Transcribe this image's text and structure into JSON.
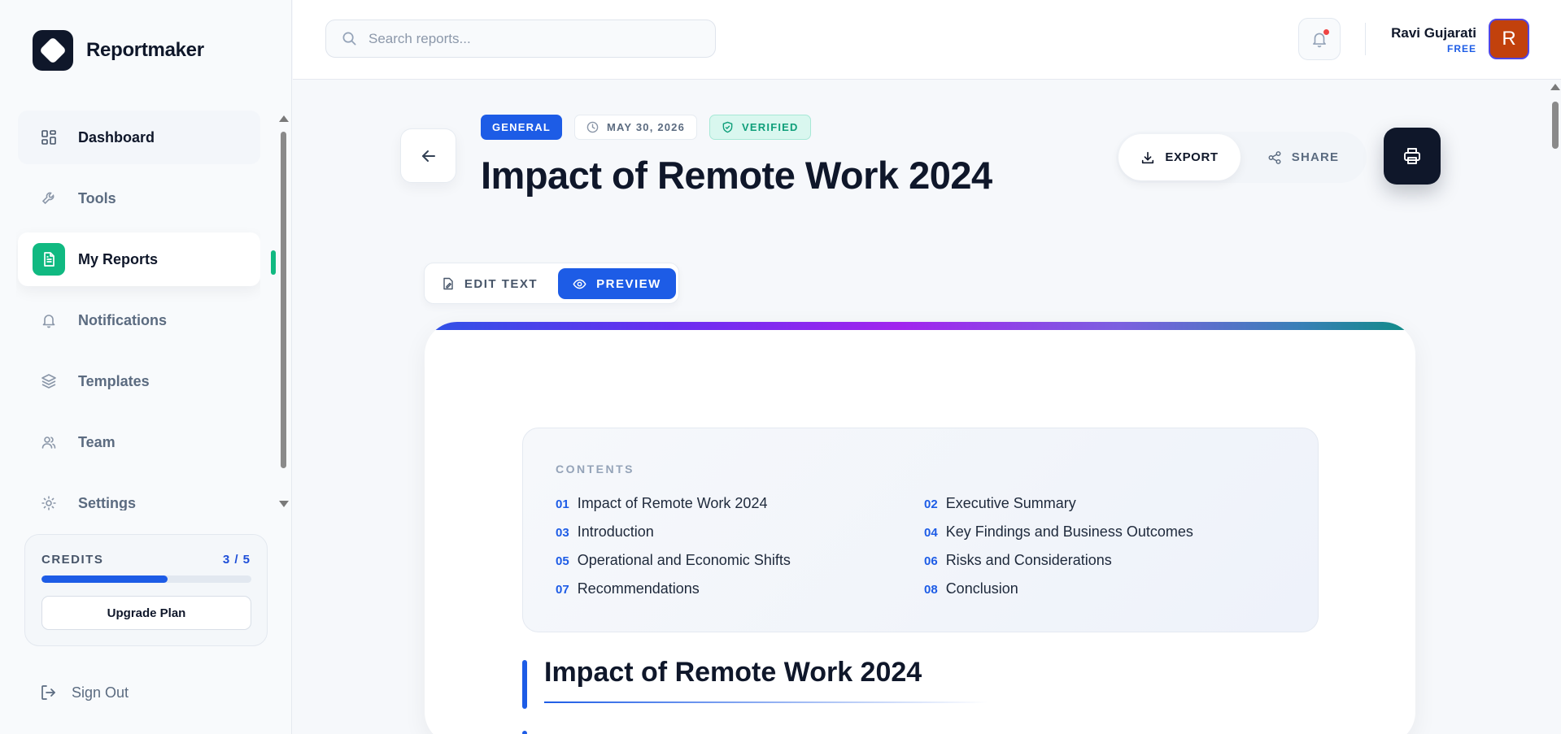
{
  "brand": {
    "name": "Reportmaker"
  },
  "sidebar": {
    "items": [
      {
        "label": "Dashboard",
        "icon": "grid-icon"
      },
      {
        "label": "Tools",
        "icon": "wrench-icon"
      },
      {
        "label": "My Reports",
        "icon": "document-icon"
      },
      {
        "label": "Notifications",
        "icon": "bell-icon"
      },
      {
        "label": "Templates",
        "icon": "layers-icon"
      },
      {
        "label": "Team",
        "icon": "users-icon"
      },
      {
        "label": "Settings",
        "icon": "gear-icon"
      }
    ],
    "active": "My Reports",
    "credits": {
      "label": "CREDITS",
      "count": "3 / 5",
      "used": 3,
      "total": 5,
      "upgrade_label": "Upgrade Plan"
    },
    "sign_out": "Sign Out"
  },
  "topbar": {
    "search_placeholder": "Search reports...",
    "user": {
      "name": "Ravi Gujarati",
      "plan": "FREE",
      "initial": "R"
    }
  },
  "report": {
    "category": "GENERAL",
    "date": "MAY 30, 2026",
    "status": "VERIFIED",
    "title": "Impact of Remote Work 2024",
    "actions": {
      "export": "EXPORT",
      "share": "SHARE"
    },
    "modes": {
      "edit": "EDIT TEXT",
      "preview": "PREVIEW",
      "active": "PREVIEW"
    }
  },
  "document": {
    "contents_label": "CONTENTS",
    "toc": [
      {
        "num": "01",
        "label": "Impact of Remote Work 2024"
      },
      {
        "num": "02",
        "label": "Executive Summary"
      },
      {
        "num": "03",
        "label": "Introduction"
      },
      {
        "num": "04",
        "label": "Key Findings and Business Outcomes"
      },
      {
        "num": "05",
        "label": "Operational and Economic Shifts"
      },
      {
        "num": "06",
        "label": "Risks and Considerations"
      },
      {
        "num": "07",
        "label": "Recommendations"
      },
      {
        "num": "08",
        "label": "Conclusion"
      }
    ],
    "heading": "Impact of Remote Work 2024"
  },
  "colors": {
    "accent": "#1d5ce6",
    "active_nav": "#10b981",
    "dark": "#0f172a",
    "verified": "#0f9f7a",
    "avatar": "#c2410c"
  }
}
